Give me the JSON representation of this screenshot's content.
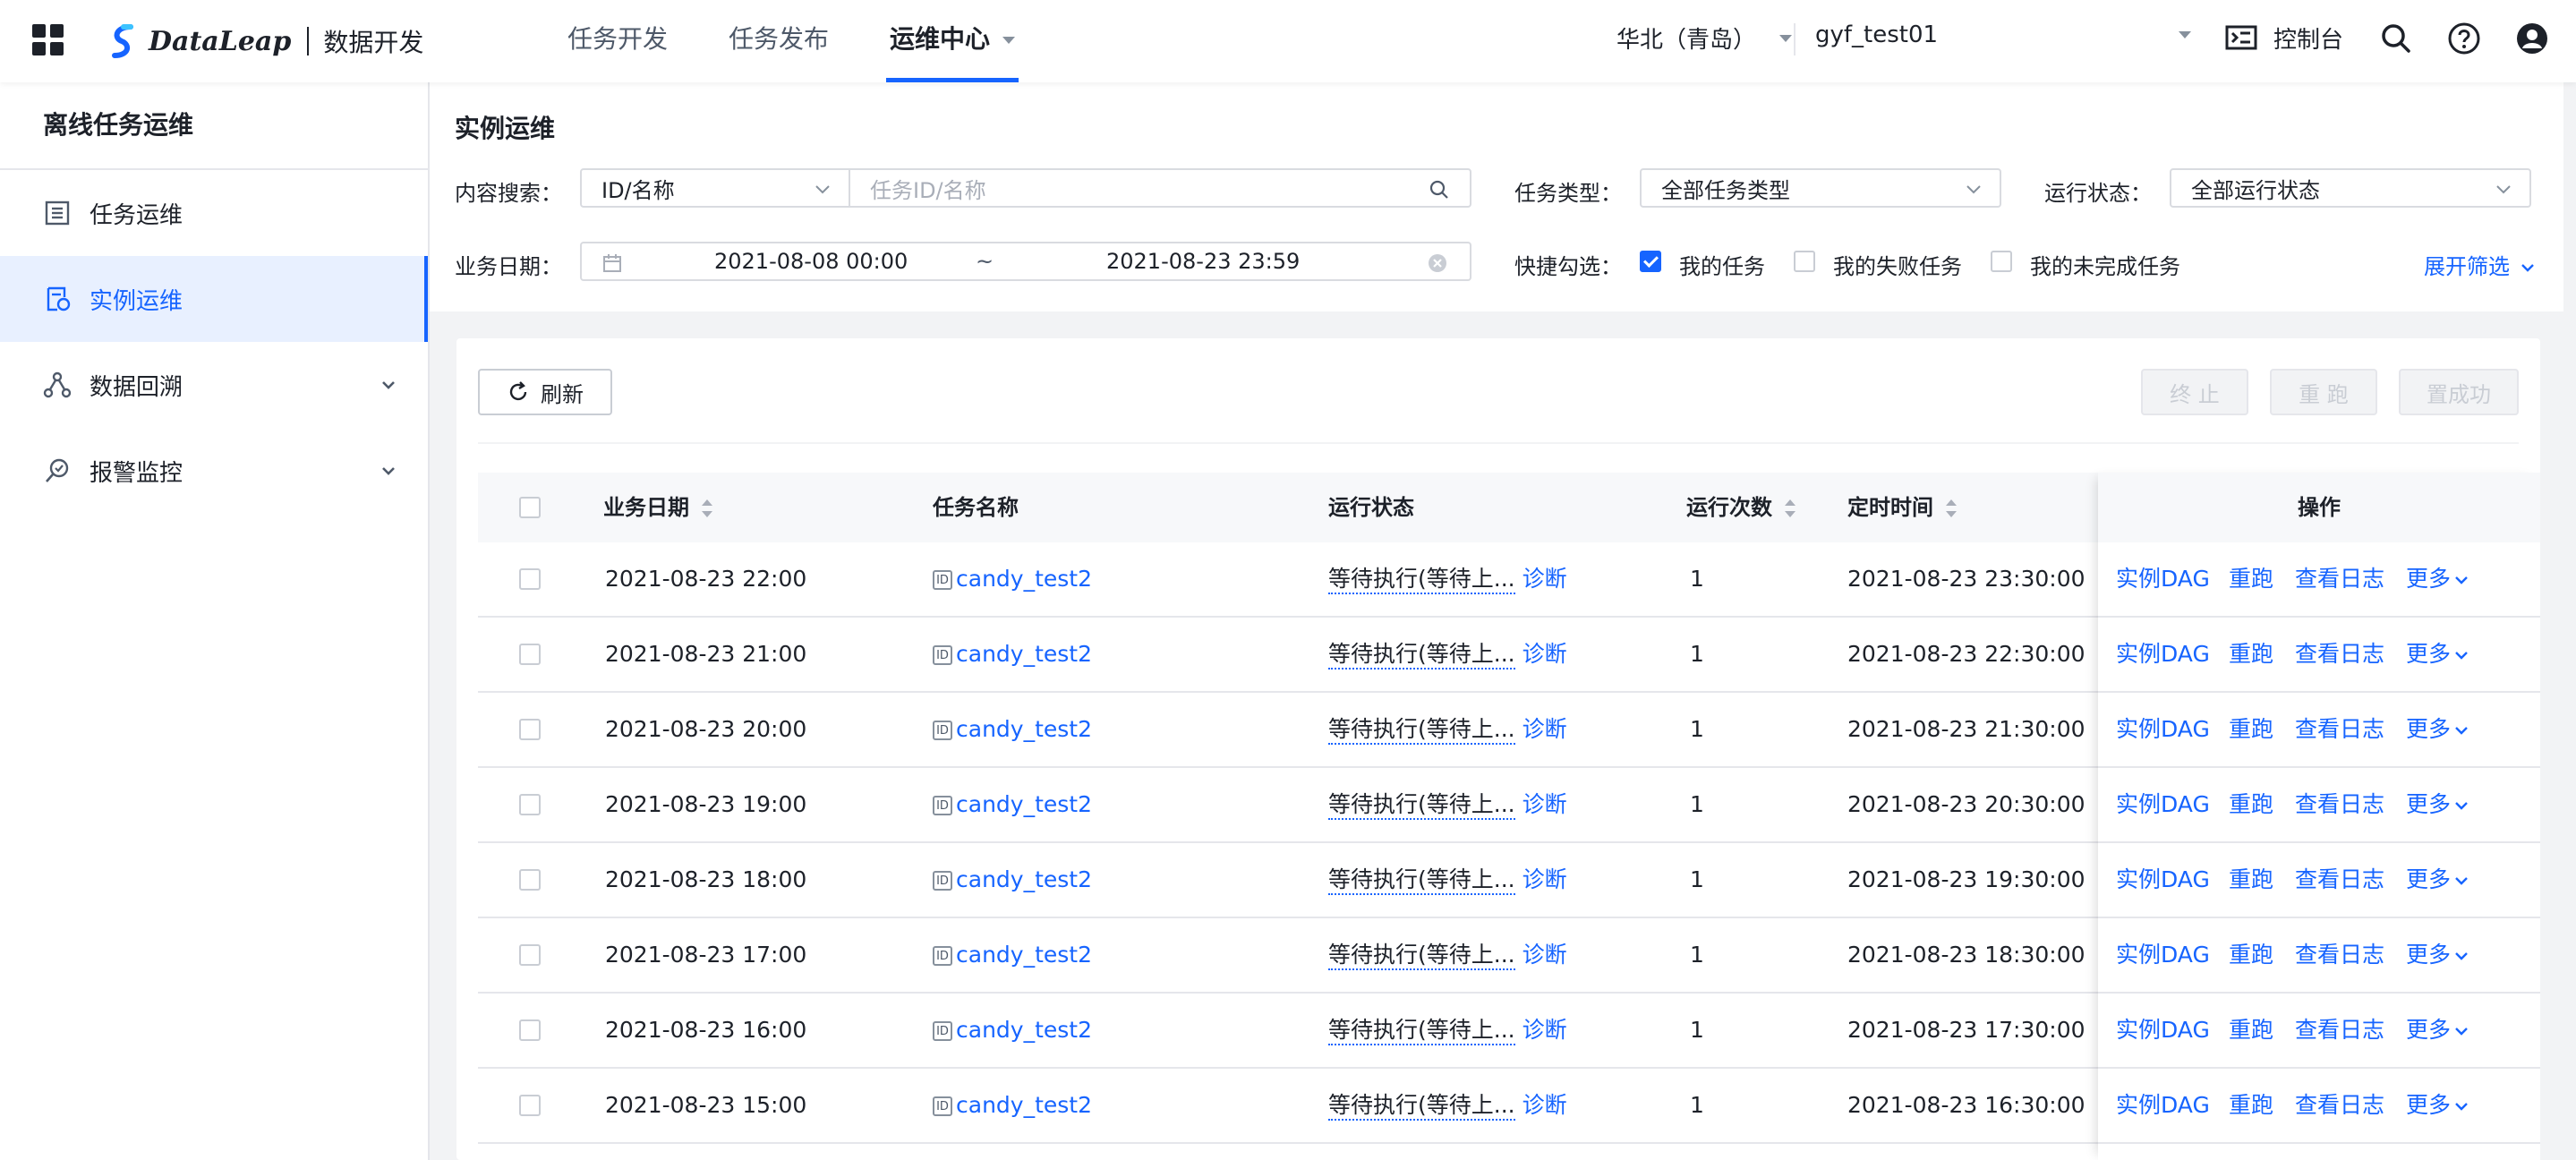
{
  "app": {
    "brand_name": "DataLeap",
    "product_name": "数据开发"
  },
  "topnav": {
    "items": [
      {
        "label": "任务开发"
      },
      {
        "label": "任务发布"
      },
      {
        "label": "运维中心",
        "active": true
      }
    ]
  },
  "header": {
    "region": "华北（青岛）",
    "account": "gyf_test01",
    "console_label": "控制台",
    "icons": [
      "apps-grid-icon",
      "console-icon",
      "search-icon",
      "help-icon",
      "user-icon"
    ]
  },
  "sidebar": {
    "title": "离线任务运维",
    "items": [
      {
        "label": "任务运维",
        "icon": "task-list-icon"
      },
      {
        "label": "实例运维",
        "icon": "instance-icon",
        "active": true
      },
      {
        "label": "数据回溯",
        "icon": "graph-node-icon",
        "expandable": true
      },
      {
        "label": "报警监控",
        "icon": "monitor-search-icon",
        "expandable": true
      }
    ]
  },
  "filters": {
    "page_title": "实例运维",
    "content_search_label": "内容搜索：",
    "search_type_value": "ID/名称",
    "search_placeholder": "任务ID/名称",
    "task_type_label": "任务类型：",
    "task_type_value": "全部任务类型",
    "run_status_label": "运行状态：",
    "run_status_value": "全部运行状态",
    "biz_date_label": "业务日期：",
    "date_start": "2021-08-08 00:00",
    "date_sep": "~",
    "date_end": "2021-08-23 23:59",
    "quick_label": "快捷勾选：",
    "quick_options": [
      {
        "label": "我的任务",
        "checked": true
      },
      {
        "label": "我的失败任务",
        "checked": false
      },
      {
        "label": "我的未完成任务",
        "checked": false
      }
    ],
    "expand_label": "展开筛选"
  },
  "toolbar": {
    "refresh_label": "刷新",
    "stop_label": "终 止",
    "rerun_label": "重 跑",
    "set_success_label": "置成功"
  },
  "table": {
    "columns": {
      "biz_date": "业务日期",
      "task_name": "任务名称",
      "run_status": "运行状态",
      "run_count": "运行次数",
      "schedule_time": "定时时间",
      "actions": "操作"
    },
    "id_tag": "ID",
    "diagnose_label": "诊断",
    "action_labels": {
      "dag": "实例DAG",
      "rerun": "重跑",
      "log": "查看日志",
      "more": "更多"
    },
    "rows": [
      {
        "biz_date": "2021-08-23 22:00",
        "task_name": "candy_test2",
        "status": "等待执行(等待上...",
        "run_count": "1",
        "schedule_time": "2021-08-23 23:30:00"
      },
      {
        "biz_date": "2021-08-23 21:00",
        "task_name": "candy_test2",
        "status": "等待执行(等待上...",
        "run_count": "1",
        "schedule_time": "2021-08-23 22:30:00"
      },
      {
        "biz_date": "2021-08-23 20:00",
        "task_name": "candy_test2",
        "status": "等待执行(等待上...",
        "run_count": "1",
        "schedule_time": "2021-08-23 21:30:00"
      },
      {
        "biz_date": "2021-08-23 19:00",
        "task_name": "candy_test2",
        "status": "等待执行(等待上...",
        "run_count": "1",
        "schedule_time": "2021-08-23 20:30:00"
      },
      {
        "biz_date": "2021-08-23 18:00",
        "task_name": "candy_test2",
        "status": "等待执行(等待上...",
        "run_count": "1",
        "schedule_time": "2021-08-23 19:30:00"
      },
      {
        "biz_date": "2021-08-23 17:00",
        "task_name": "candy_test2",
        "status": "等待执行(等待上...",
        "run_count": "1",
        "schedule_time": "2021-08-23 18:30:00"
      },
      {
        "biz_date": "2021-08-23 16:00",
        "task_name": "candy_test2",
        "status": "等待执行(等待上...",
        "run_count": "1",
        "schedule_time": "2021-08-23 17:30:00"
      },
      {
        "biz_date": "2021-08-23 15:00",
        "task_name": "candy_test2",
        "status": "等待执行(等待上...",
        "run_count": "1",
        "schedule_time": "2021-08-23 16:30:00"
      }
    ]
  },
  "colors": {
    "accent": "#1664ff",
    "text": "#1d2129",
    "active_bg": "#e8f0ff",
    "page_bg": "#f2f3f5"
  }
}
